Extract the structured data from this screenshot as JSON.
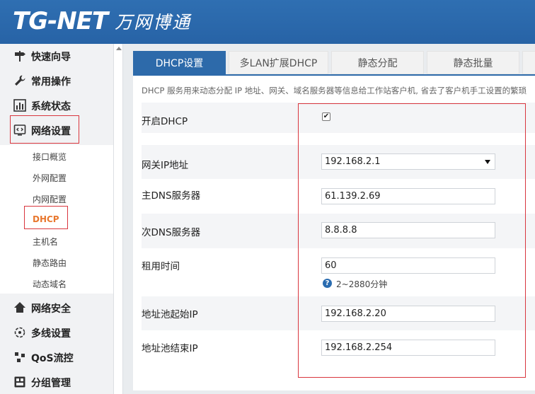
{
  "brand": {
    "logo_en": "TG-NET",
    "logo_cn": "万网博通"
  },
  "sidebar": {
    "items": [
      {
        "label": "快速向导",
        "icon": "signpost-icon"
      },
      {
        "label": "常用操作",
        "icon": "wrench-icon"
      },
      {
        "label": "系统状态",
        "icon": "chart-icon"
      },
      {
        "label": "网络设置",
        "icon": "network-icon"
      },
      {
        "label": "网络安全",
        "icon": "security-icon"
      },
      {
        "label": "多线设置",
        "icon": "multiline-icon"
      },
      {
        "label": "QoS流控",
        "icon": "qos-icon"
      },
      {
        "label": "分组管理",
        "icon": "group-icon"
      }
    ],
    "subitems": [
      "接口概览",
      "外网配置",
      "内网配置",
      "DHCP",
      "主机名",
      "静态路由",
      "动态域名"
    ]
  },
  "tabs": [
    "DHCP设置",
    "多LAN扩展DHCP",
    "静态分配",
    "静态批量"
  ],
  "description": "DHCP 服务用来动态分配 IP 地址、网关、域名服务器等信息给工作站客户机, 省去了客户机手工设置的繁琐",
  "form": {
    "enable_label": "开启DHCP",
    "enable_checked": true,
    "gateway_label": "网关IP地址",
    "gateway_value": "192.168.2.1",
    "dns1_label": "主DNS服务器",
    "dns1_value": "61.139.2.69",
    "dns2_label": "次DNS服务器",
    "dns2_value": "8.8.8.8",
    "lease_label": "租用时间",
    "lease_value": "60",
    "lease_hint": "2~2880分钟",
    "pool_start_label": "地址池起始IP",
    "pool_start_value": "192.168.2.20",
    "pool_end_label": "地址池结束IP",
    "pool_end_value": "192.168.2.254"
  },
  "colors": {
    "header": "#2763a6",
    "active_tab": "#2d6aaa",
    "active_subitem": "#e8772e",
    "highlight": "#d9363e"
  }
}
